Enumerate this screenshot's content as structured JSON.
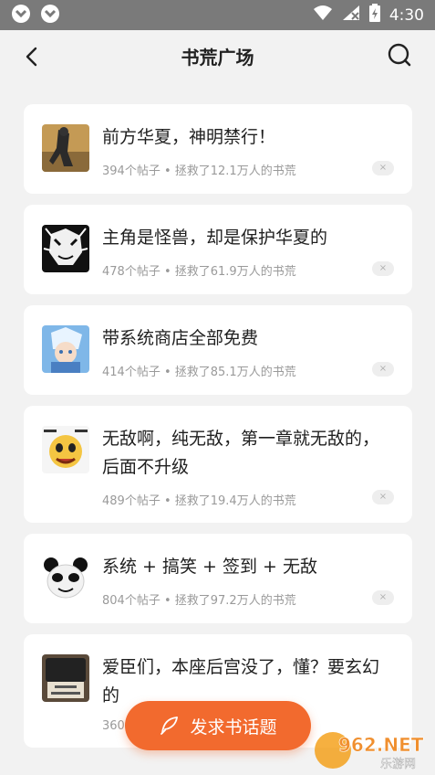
{
  "status_bar": {
    "time": "4:30"
  },
  "header": {
    "title": "书荒广场"
  },
  "topics": [
    {
      "title": "前方华夏，神明禁行！",
      "meta": "394个帖子 • 拯救了12.1万人的书荒"
    },
    {
      "title": "主角是怪兽，却是保护华夏的",
      "meta": "478个帖子 • 拯救了61.9万人的书荒"
    },
    {
      "title": "带系统商店全部免费",
      "meta": "414个帖子 • 拯救了85.1万人的书荒"
    },
    {
      "title": "无敌啊，纯无敌，第一章就无敌的，后面不升级",
      "meta": "489个帖子 • 拯救了19.4万人的书荒"
    },
    {
      "title": "系统 + 搞笑 + 签到 + 无敌",
      "meta": "804个帖子 • 拯救了97.2万人的书荒"
    },
    {
      "title": "爱臣们，本座后宫没了，懂？要玄幻的",
      "meta": "360"
    }
  ],
  "close_glyph": "×",
  "fab": {
    "label": "发求书话题"
  },
  "watermark": {
    "brand": "962.NET",
    "sub": "乐游网"
  }
}
